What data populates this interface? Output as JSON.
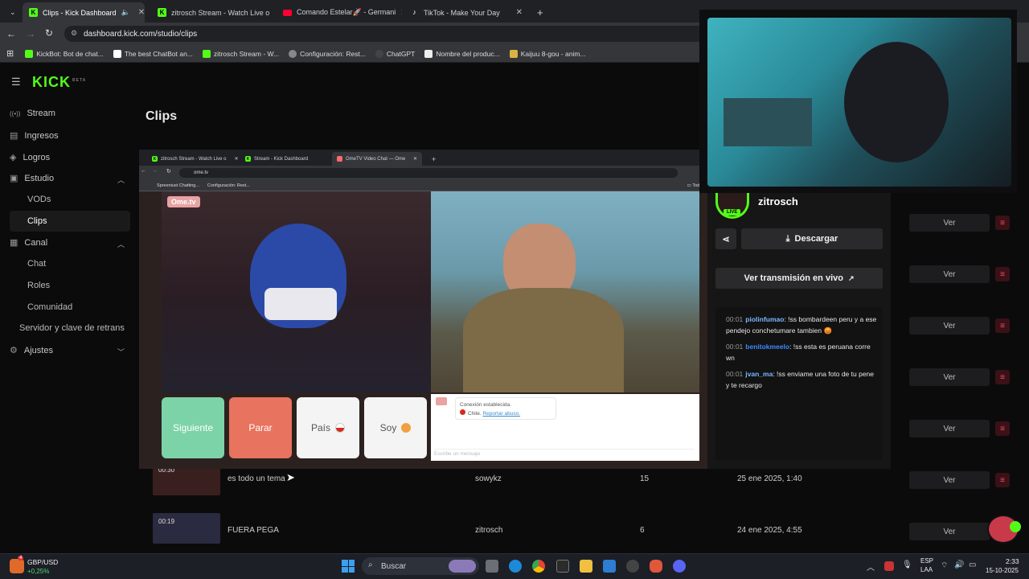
{
  "browser": {
    "tabs": [
      {
        "label": "Clips - Kick Dashboard",
        "favicon": "kick"
      },
      {
        "label": "zitrosch Stream - Watch Live o",
        "favicon": "kick"
      },
      {
        "label": "Comando Estelar🚀 - Germani",
        "favicon": "youtube"
      },
      {
        "label": "TikTok - Make Your Day",
        "favicon": "tiktok"
      }
    ],
    "url": "dashboard.kick.com/studio/clips",
    "bookmarks": [
      "KickBot: Bot de chat...",
      "The best ChatBot an...",
      "zitrosch Stream - W...",
      "Configuración: Rest...",
      "ChatGPT",
      "Nombre del produc...",
      "Kaijuu 8-gou - anim..."
    ]
  },
  "sidebar": {
    "logo": "KICK",
    "logo_badge": "BETA",
    "items": [
      {
        "label": "Stream",
        "icon": "stream-icon"
      },
      {
        "label": "Ingresos",
        "icon": "revenue-icon"
      },
      {
        "label": "Logros",
        "icon": "achievements-icon"
      },
      {
        "label": "Estudio",
        "icon": "studio-icon"
      },
      {
        "label": "VODs"
      },
      {
        "label": "Clips"
      },
      {
        "label": "Canal",
        "icon": "channel-icon"
      },
      {
        "label": "Chat"
      },
      {
        "label": "Roles"
      },
      {
        "label": "Comunidad"
      },
      {
        "label": "Servidor y clave de retrans"
      },
      {
        "label": "Ajustes",
        "icon": "settings-icon"
      }
    ]
  },
  "main": {
    "title": "Clips",
    "rows": [
      {
        "duration": "00:30",
        "title": "es todo un tema",
        "author": "sowykz",
        "views": "15",
        "date": "25 ene 2025, 1:40"
      },
      {
        "duration": "00:19",
        "title": "FUERA PEGA",
        "author": "zitrosch",
        "views": "6",
        "date": "24 ene 2025, 4:55"
      }
    ],
    "row_button": "Ver"
  },
  "embedded": {
    "tabs": [
      "zitrosch Stream - Watch Live o",
      "Stream - Kick Dashboard",
      "OmeTV Video Chat — Ome"
    ],
    "url": "ome.tv",
    "bookmarks": [
      "Spreeniust Chatting...",
      "Configuración: Rest..."
    ],
    "bookmarks_folder": "Todos",
    "logo": "Ome.tv",
    "buttons": {
      "next": "Siguiente",
      "stop": "Parar",
      "country": "País",
      "me": "Soy"
    },
    "chat": {
      "status": "Conexión establecida.",
      "country": "Chile.",
      "report": "Reportar abuso.",
      "placeholder": "Escribe un mensaje"
    }
  },
  "clip_panel": {
    "streamer": "zitrosch",
    "live_badge": "LIVE",
    "download": "Descargar",
    "watch_live": "Ver transmisión en vivo",
    "messages": [
      {
        "time": "00:01",
        "user": "piolinfumao",
        "text": ": !ss bombardeen peru y a ese pendejo conchetumare tambien 😡"
      },
      {
        "time": "00:01",
        "user": "benitokmeelo",
        "text": ": !ss esta es peruana corre wn"
      },
      {
        "time": "00:01",
        "user": "jvan_ma",
        "text": ": !ss enviame una foto de tu pene y te recargo"
      }
    ]
  },
  "taskbar": {
    "ticker_name": "GBP/USD",
    "ticker_change": "+0,25%",
    "ticker_badge": "4",
    "search_placeholder": "Buscar",
    "lang": "ESP",
    "region": "LAA",
    "time": "2:33",
    "date": "15-10-2025"
  },
  "colors": {
    "kick_green": "#53fc18",
    "danger": "#ff4d6d",
    "next_green": "#7dd3a8",
    "stop_red": "#e8735e"
  }
}
